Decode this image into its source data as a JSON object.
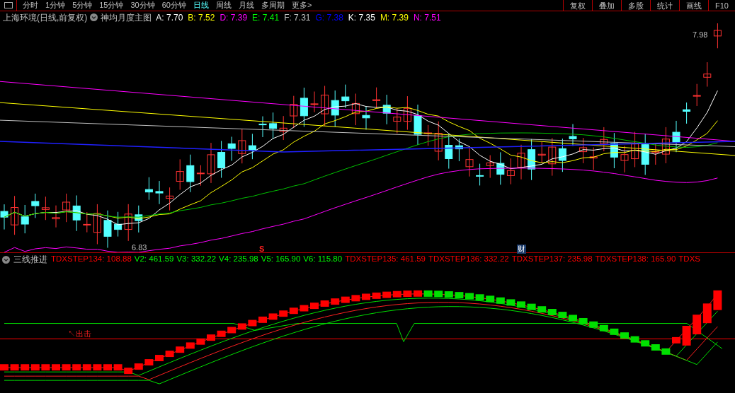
{
  "toolbar": {
    "periods": [
      {
        "label": "分时",
        "selected": false
      },
      {
        "label": "1分钟",
        "selected": false
      },
      {
        "label": "5分钟",
        "selected": false
      },
      {
        "label": "15分钟",
        "selected": false
      },
      {
        "label": "30分钟",
        "selected": false
      },
      {
        "label": "60分钟",
        "selected": false
      },
      {
        "label": "日线",
        "selected": true
      },
      {
        "label": "周线",
        "selected": false
      },
      {
        "label": "月线",
        "selected": false
      },
      {
        "label": "多周期",
        "selected": false
      },
      {
        "label": "更多>",
        "selected": false
      }
    ],
    "buttons": [
      "复权",
      "叠加",
      "多股",
      "统计",
      "画线",
      "F10"
    ]
  },
  "main_chart": {
    "title": "上海环境(日线,前复权)",
    "indicator_name": "神均月度主图",
    "values": [
      {
        "label": "A: 7.70",
        "color": "#ffffff"
      },
      {
        "label": "B: 7.52",
        "color": "#ffff00"
      },
      {
        "label": "D: 7.39",
        "color": "#ff00ff"
      },
      {
        "label": "E: 7.41",
        "color": "#00ff00"
      },
      {
        "label": "F: 7.31",
        "color": "#c0c0c0"
      },
      {
        "label": "G: 7.38",
        "color": "#0000ff"
      },
      {
        "label": "K: 7.35",
        "color": "#ffffff"
      },
      {
        "label": "M: 7.39",
        "color": "#ffff00"
      },
      {
        "label": "N: 7.51",
        "color": "#ff00ff"
      }
    ],
    "high_label": "7.98",
    "low_label": "6.83",
    "markers": [
      {
        "kind": "signal",
        "text": "S"
      },
      {
        "kind": "info",
        "text": "财"
      }
    ]
  },
  "sub_chart": {
    "indicator_name": "三线推进",
    "values": [
      {
        "label": "TDXSTEP134: 108.88",
        "color": "#ff0000"
      },
      {
        "label": "V2: 461.59",
        "color": "#00ff00"
      },
      {
        "label": "V3: 332.22",
        "color": "#00ff00"
      },
      {
        "label": "V4: 235.98",
        "color": "#00ff00"
      },
      {
        "label": "V5: 165.90",
        "color": "#00ff00"
      },
      {
        "label": "V6: 115.80",
        "color": "#00ff00"
      },
      {
        "label": "TDXSTEP135: 461.59",
        "color": "#ff0000"
      },
      {
        "label": "TDXSTEP136: 332.22",
        "color": "#ff0000"
      },
      {
        "label": "TDXSTEP137: 235.98",
        "color": "#ff0000"
      },
      {
        "label": "TDXSTEP138: 165.90",
        "color": "#ff0000"
      },
      {
        "label": "TDXS",
        "color": "#ff0000"
      }
    ],
    "signal_label": "↖出击"
  }
}
